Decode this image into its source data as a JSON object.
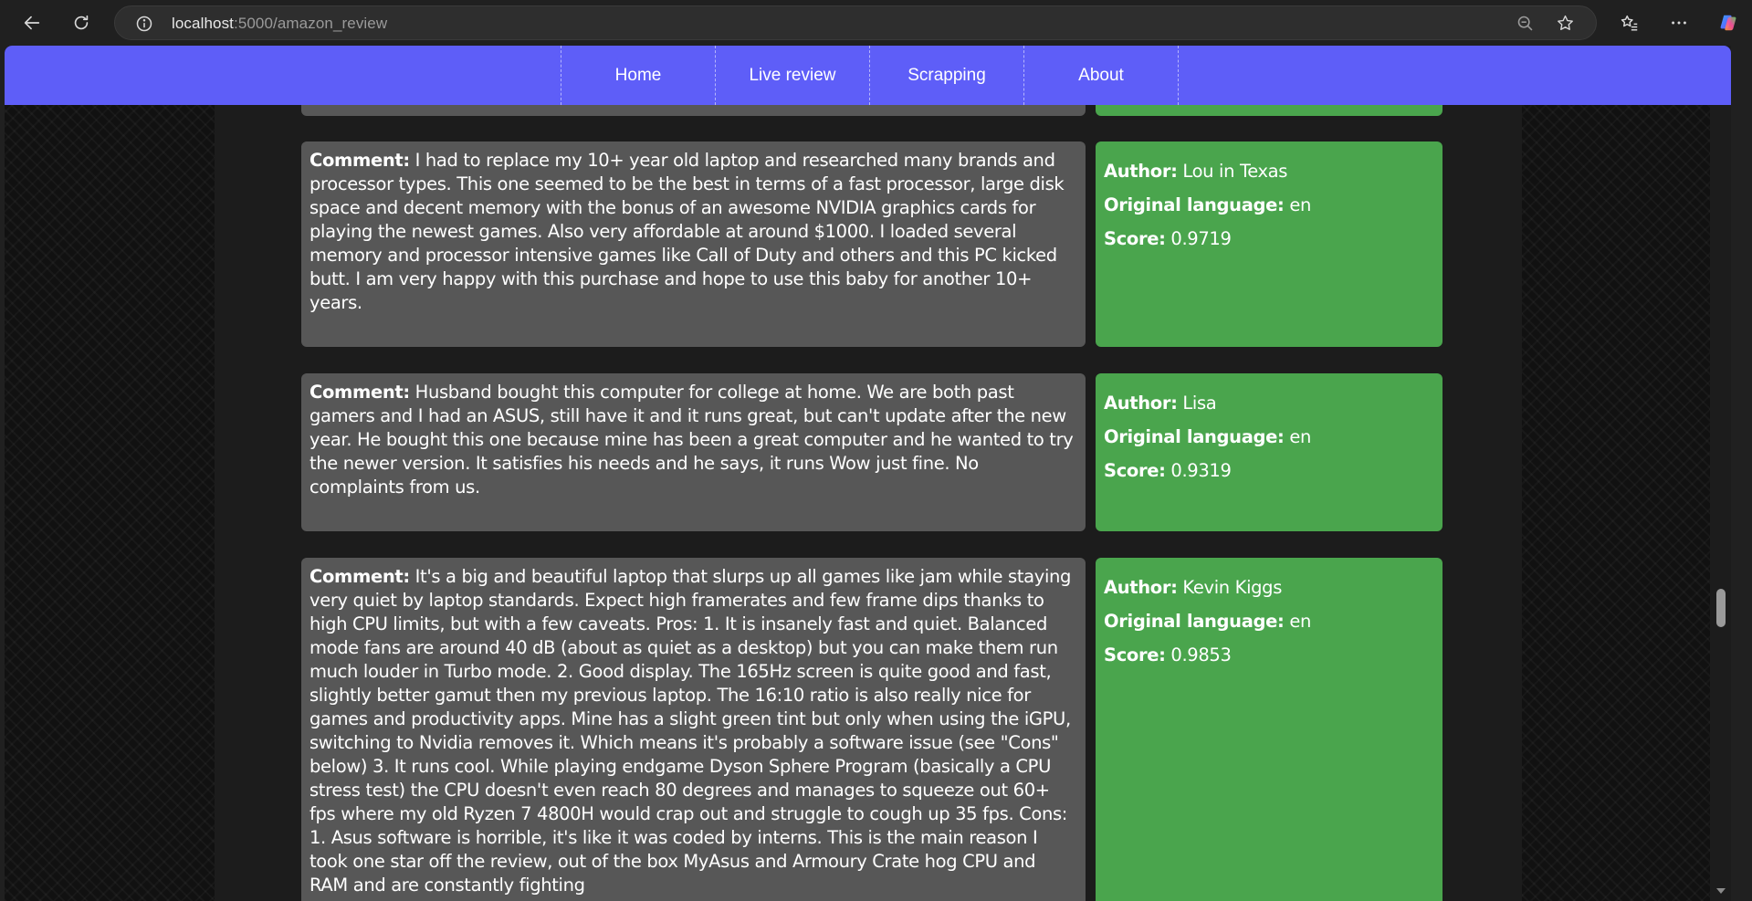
{
  "browser": {
    "url_host": "localhost",
    "url_path": ":5000/amazon_review"
  },
  "navbar": {
    "links": [
      {
        "label": "Home"
      },
      {
        "label": "Live review"
      },
      {
        "label": "Scrapping"
      },
      {
        "label": "About"
      }
    ]
  },
  "labels": {
    "comment": "Comment:",
    "author": "Author:",
    "language": "Original language:",
    "score": "Score:"
  },
  "reviews": [
    {
      "comment": "I had to replace my 10+ year old laptop and researched many brands and processor types. This one seemed to be the best in terms of a fast processor, large disk space and decent memory with the bonus of an awesome NVIDIA graphics cards for playing the newest games. Also very affordable at around $1000. I loaded several memory and processor intensive games like Call of Duty and others and this PC kicked butt. I am very happy with this purchase and hope to use this baby for another 10+ years.",
      "author": "Lou in Texas",
      "language": "en",
      "score": "0.9719"
    },
    {
      "comment": "Husband bought this computer for college at home. We are both past gamers and I had an ASUS, still have it and it runs great, but can't update after the new year. He bought this one because mine has been a great computer and he wanted to try the newer version. It satisfies his needs and he says, it runs Wow just fine. No complaints from us.",
      "author": "Lisa",
      "language": "en",
      "score": "0.9319"
    },
    {
      "comment": "It's a big and beautiful laptop that slurps up all games like jam while staying very quiet by laptop standards. Expect high framerates and few frame dips thanks to high CPU limits, but with a few caveats. Pros: 1. It is insanely fast and quiet. Balanced mode fans are around 40 dB (about as quiet as a desktop) but you can make them run much louder in Turbo mode. 2. Good display. The 165Hz screen is quite good and fast, slightly better gamut then my previous laptop. The 16:10 ratio is also really nice for games and productivity apps. Mine has a slight green tint but only when using the iGPU, switching to Nvidia removes it. Which means it's probably a software issue (see \"Cons\" below) 3. It runs cool. While playing endgame Dyson Sphere Program (basically a CPU stress test) the CPU doesn't even reach 80 degrees and manages to squeeze out 60+ fps where my old Ryzen 7 4800H would crap out and struggle to cough up 35 fps. Cons: 1. Asus software is horrible, it's like it was coded by interns. This is the main reason I took one star off the review, out of the box MyAsus and Armoury Crate hog CPU and RAM and are constantly fighting",
      "author": "Kevin Kiggs",
      "language": "en",
      "score": "0.9853"
    }
  ]
}
